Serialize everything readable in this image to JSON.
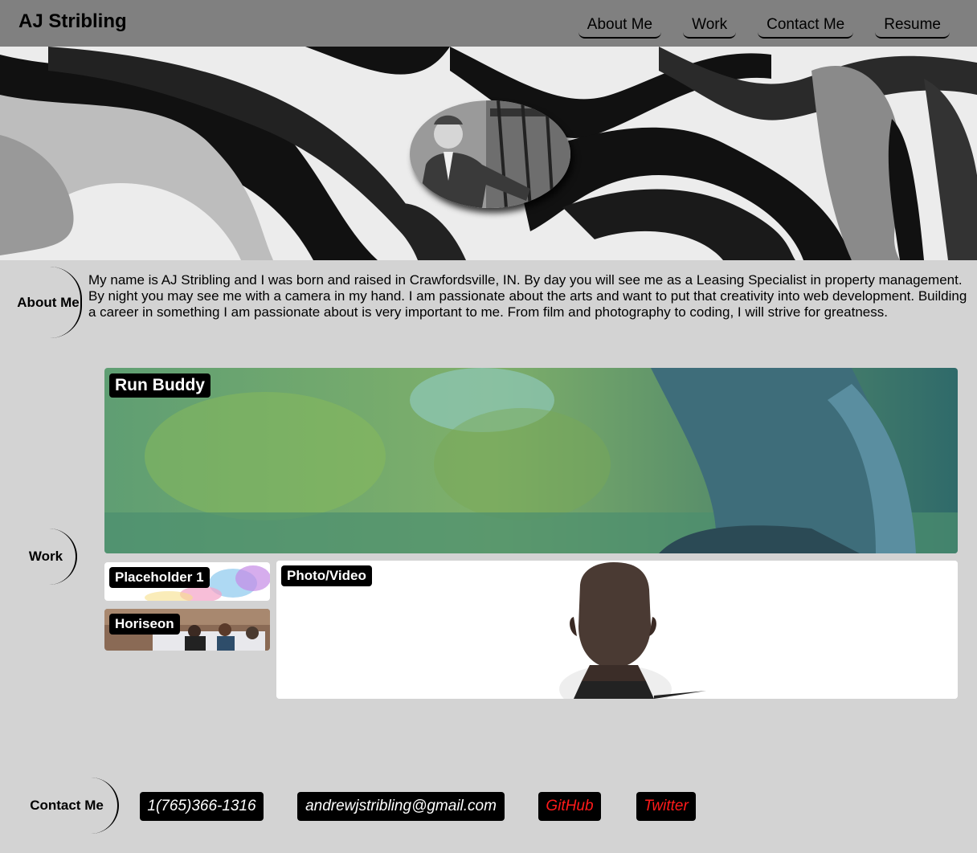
{
  "header": {
    "brand": "AJ Stribling",
    "nav": [
      "About Me",
      "Work",
      "Contact Me",
      "Resume"
    ]
  },
  "about": {
    "label": "About Me",
    "text": "My name is AJ Stribling and I was born and raised in Crawfordsville, IN. By day you will see me as a Leasing Specialist in property management. By night you may see me with a camera in my hand. I am passionate about the arts and want to put that creativity into web development. Building a career in something I am passionate about is very important to me. From film and photography to coding, I will strive for greatness."
  },
  "work": {
    "label": "Work",
    "projects": [
      "Run Buddy",
      "Placeholder 1",
      "Horiseon",
      "Photo/Video"
    ]
  },
  "contact": {
    "label": "Contact Me",
    "items": [
      {
        "text": "1(765)366-1316",
        "color": "#ffffff"
      },
      {
        "text": "andrewjstribling@gmail.com",
        "color": "#ffffff"
      },
      {
        "text": "GitHub",
        "color": "#ff1a1a"
      },
      {
        "text": "Twitter",
        "color": "#ff1a1a"
      }
    ]
  }
}
